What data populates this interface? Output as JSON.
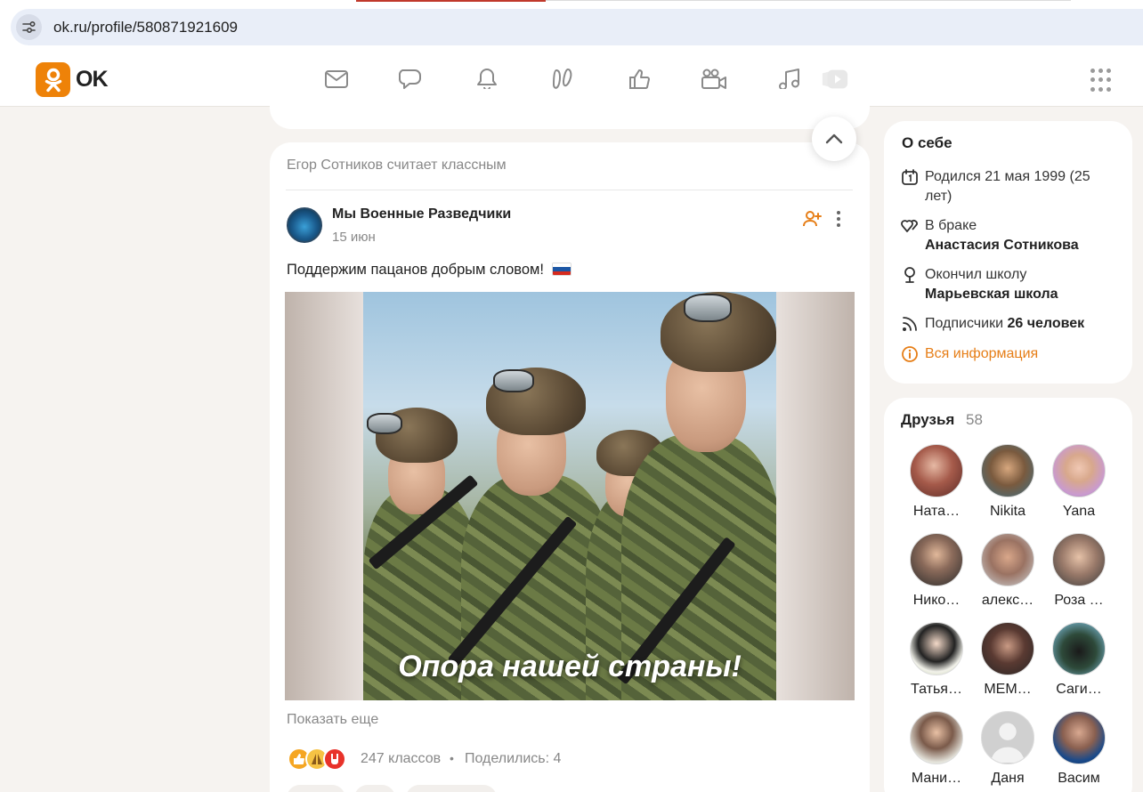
{
  "browser": {
    "url": "ok.ru/profile/580871921609"
  },
  "header": {
    "logo_text": "OK",
    "nav_icons": [
      "mail-icon",
      "chat-icon",
      "bell-icon",
      "guests-icon",
      "like-icon",
      "video-camera-icon",
      "music-icon",
      "video-play-icon"
    ],
    "apps_icon": "grid-icon"
  },
  "post": {
    "liked_by": "Егор Сотников считает классным",
    "group_name": "Мы Военные Разведчики",
    "date": "15 июн",
    "text": "Поддержим пацанов добрым словом!",
    "image_caption": "Опора нашей страны!",
    "show_more": "Показать еще",
    "likes": "247 классов",
    "separator": "•",
    "shared": "Поделились: 4",
    "reaction_icons": [
      "thumbs-up-icon",
      "praying-hands-icon",
      "rock-hand-icon"
    ]
  },
  "about": {
    "title": "О себе",
    "born": "Родился 21 мая 1999 (25 лет)",
    "marriage_label": "В браке",
    "marriage_partner": "Анастасия Сотникова",
    "school_label": "Окончил школу",
    "school_name": "Марьевская школа",
    "subscribers_label": "Подписчики",
    "subscribers_value": "26 человек",
    "all_info": "Вся информация"
  },
  "friends": {
    "title": "Друзья",
    "count": "58",
    "items": [
      {
        "name": "Ната…"
      },
      {
        "name": "Nikita"
      },
      {
        "name": "Yana"
      },
      {
        "name": "Нико…"
      },
      {
        "name": "алекс…"
      },
      {
        "name": "Роза …"
      },
      {
        "name": "Татья…"
      },
      {
        "name": "МЕМ…"
      },
      {
        "name": "Саги…"
      },
      {
        "name": "Мани…"
      },
      {
        "name": "Даня"
      },
      {
        "name": "Васим"
      }
    ]
  },
  "colors": {
    "accent": "#ee8208",
    "link": "#e67e17",
    "page_bg": "#f6f3f0"
  }
}
